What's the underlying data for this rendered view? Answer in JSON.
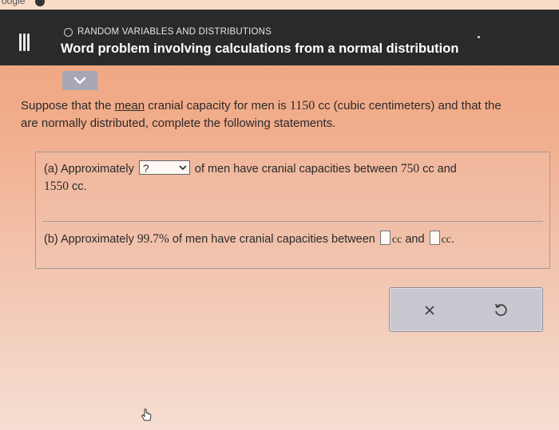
{
  "browser": {
    "tab_fragment": "oogle"
  },
  "header": {
    "section_label": "RANDOM VARIABLES AND DISTRIBUTIONS",
    "title": "Word problem involving calculations from a normal distribution"
  },
  "icons": {
    "menu": "menu-icon",
    "section": "circle-icon",
    "collapse": "chevron-down-icon",
    "select": "chevron-down-icon",
    "clear": "x-icon",
    "undo": "undo-icon",
    "cursor": "pointer-cursor-icon"
  },
  "colors": {
    "header_bg": "#2a2a2c",
    "collapse_bg": "#a7a7b5",
    "action_panel_bg": "#c9c7cf"
  },
  "problem": {
    "intro_part1": "Suppose that the ",
    "intro_mean": "mean",
    "intro_part2": " cranial capacity for men is ",
    "intro_value": "1150",
    "intro_part3": " cc (cubic centimeters) and that the",
    "intro_line2": "are normally distributed, complete the following statements."
  },
  "part_a": {
    "prefix": "(a) Approximately",
    "selected": "?",
    "middle": " of men have cranial capacities between ",
    "low": "750",
    "cc1": " cc and",
    "high": "1550",
    "cc2": " cc."
  },
  "part_b": {
    "prefix": "(b) Approximately ",
    "percent": "99.7%",
    "middle": " of men have cranial capacities between ",
    "cc1": "cc",
    "and": " and ",
    "cc2": "cc",
    "period": "."
  }
}
